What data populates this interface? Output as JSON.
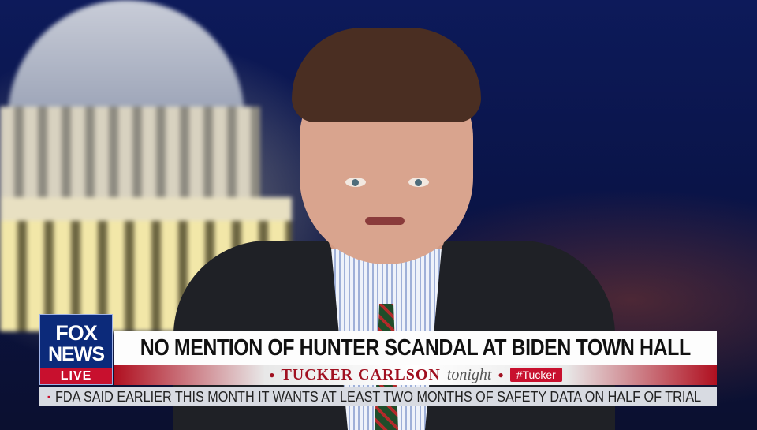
{
  "logo": {
    "fox": "FOX",
    "news": "NEWS",
    "live": "LIVE"
  },
  "lower_third": {
    "headline": "NO MENTION OF HUNTER SCANDAL AT BIDEN TOWN HALL",
    "show_name": "TUCKER CARLSON",
    "show_suffix": "tonight",
    "hashtag": "#Tucker"
  },
  "ticker": {
    "text": "FDA SAID EARLIER THIS MONTH IT WANTS AT LEAST TWO MONTHS OF SAFETY DATA ON HALF OF TRIAL"
  },
  "colors": {
    "brand_blue": "#0c2a7a",
    "brand_red": "#c8102e",
    "background_blue": "#0d1a5a"
  }
}
